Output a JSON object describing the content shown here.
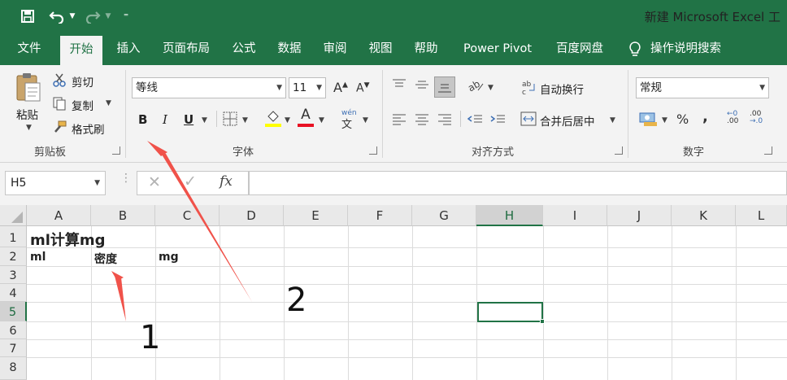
{
  "title_bar": {
    "title": "新建 Microsoft Excel 工",
    "customize_glyph": "⁼"
  },
  "tabs": [
    {
      "label": "文件"
    },
    {
      "label": "开始"
    },
    {
      "label": "插入"
    },
    {
      "label": "页面布局"
    },
    {
      "label": "公式"
    },
    {
      "label": "数据"
    },
    {
      "label": "审阅"
    },
    {
      "label": "视图"
    },
    {
      "label": "帮助"
    },
    {
      "label": "Power Pivot"
    },
    {
      "label": "百度网盘"
    }
  ],
  "tell_me": {
    "label": "操作说明搜索"
  },
  "ribbon": {
    "clipboard": {
      "paste": "粘贴",
      "cut": "剪切",
      "copy": "复制",
      "format_painter": "格式刷",
      "group": "剪贴板"
    },
    "font": {
      "name": "等线",
      "size": "11",
      "bold": "B",
      "italic": "I",
      "underline": "U",
      "font_color_letter": "A",
      "grow_letter": "A",
      "shrink_letter": "A",
      "phonetic": "wén",
      "group": "字体"
    },
    "alignment": {
      "wrap_text": "自动换行",
      "merge_center": "合并后居中",
      "group": "对齐方式"
    },
    "number": {
      "format": "常规",
      "percent": "%",
      "comma": ",",
      "increase_decimal": ".00",
      "decrease_decimal": ".00",
      "group": "数字"
    }
  },
  "formula_bar": {
    "name_box": "H5",
    "cancel": "✕",
    "enter": "✓",
    "fx": "fx"
  },
  "grid": {
    "columns": [
      "A",
      "B",
      "C",
      "D",
      "E",
      "F",
      "G",
      "H",
      "I",
      "J",
      "K",
      "L"
    ],
    "rows": [
      "1",
      "2",
      "3",
      "4",
      "5",
      "6",
      "7",
      "8"
    ],
    "selected_cell": "H5",
    "cells": {
      "A1": "ml计算mg",
      "A2": "ml",
      "B2": "密度",
      "C2": "mg"
    }
  },
  "annotations": {
    "label_1": "1",
    "label_2": "2",
    "arrow_color": "#f0524a"
  },
  "colors": {
    "accent": "#217346"
  }
}
